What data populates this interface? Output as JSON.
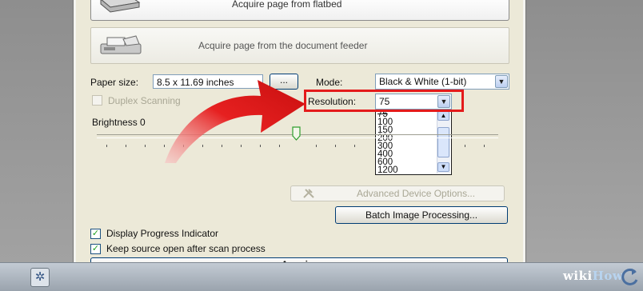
{
  "dialog": {
    "top_option_label": "Acquire page from flatbed",
    "feeder_option_label": "Acquire page from the document feeder",
    "paper_size_label": "Paper size:",
    "paper_size_value": "8.5 x 11.69 inches",
    "browse_button_label": "...",
    "mode_label": "Mode:",
    "mode_value": "Black & White (1-bit)",
    "duplex_label": "Duplex Scanning",
    "resolution_label": "Resolution:",
    "resolution_value": "75",
    "resolution_options": [
      "75",
      "100",
      "150",
      "200",
      "300",
      "400",
      "600",
      "1200"
    ],
    "brightness_label": "Brightness 0",
    "brightness_value": 0,
    "advanced_button_label": "Advanced Device Options...",
    "batch_button_label": "Batch Image Processing...",
    "progress_label": "Display Progress Indicator",
    "progress_checked": true,
    "keep_open_label": "Keep source open after scan process",
    "keep_open_checked": true,
    "acquire_button_label": "Acquire"
  },
  "watermark": {
    "text_part1": "wiki",
    "text_part2": "How"
  },
  "colors": {
    "highlight": "#e41b1b",
    "dialog_bg": "#ece9d8",
    "arrow": "#e62020"
  },
  "icons": {
    "scanner": "scanner-icon",
    "tools": "tools-icon",
    "gear": "gear-icon",
    "dropdown": "chevron-down-icon",
    "annotation": "red-curved-arrow-icon"
  }
}
